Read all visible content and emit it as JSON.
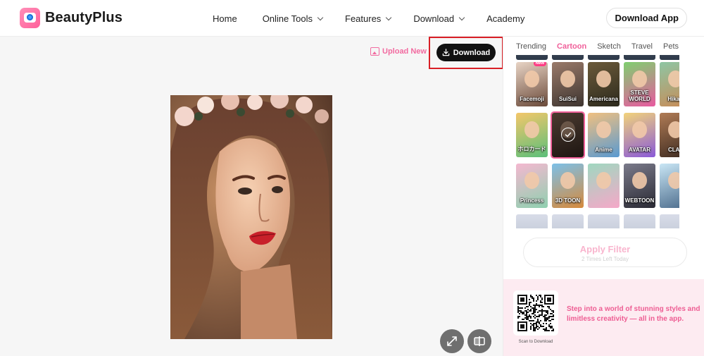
{
  "brand": {
    "name": "BeautyPlus"
  },
  "nav": [
    {
      "label": "Home",
      "dropdown": false
    },
    {
      "label": "Online Tools",
      "dropdown": true
    },
    {
      "label": "Features",
      "dropdown": true
    },
    {
      "label": "Download",
      "dropdown": true
    },
    {
      "label": "Academy",
      "dropdown": false
    }
  ],
  "header": {
    "download_app": "Download App"
  },
  "toolbar": {
    "upload_new": "Upload New",
    "download": "Download"
  },
  "tabs": [
    {
      "label": "Trending",
      "active": false
    },
    {
      "label": "Cartoon",
      "active": true
    },
    {
      "label": "Sketch",
      "active": false
    },
    {
      "label": "Travel",
      "active": false
    },
    {
      "label": "Pets",
      "active": false
    }
  ],
  "filters": [
    {
      "caption": "Facemoji",
      "badge": "New",
      "colors": [
        "#e8d4c5",
        "#6b4a3a"
      ]
    },
    {
      "caption": "SuiSui",
      "colors": [
        "#9a7a6a",
        "#3e3530"
      ]
    },
    {
      "caption": "Americana",
      "colors": [
        "#6b5a3a",
        "#2d2a1d"
      ]
    },
    {
      "caption": "STEVE WORLD",
      "colors": [
        "#7fcf6f",
        "#e85aa0"
      ]
    },
    {
      "caption": "Hikari",
      "colors": [
        "#8ec6a4",
        "#c98a55"
      ]
    },
    {
      "caption": "ホロカード",
      "colors": [
        "#f4c76a",
        "#5bbf7a"
      ]
    },
    {
      "caption": "",
      "selected": true,
      "colors": [
        "#4a3a30",
        "#1e1612"
      ]
    },
    {
      "caption": "Anime",
      "colors": [
        "#f0c080",
        "#5a9ad0"
      ]
    },
    {
      "caption": "AVATAR",
      "colors": [
        "#f2d37a",
        "#8a5ad8"
      ]
    },
    {
      "caption": "CLAY",
      "colors": [
        "#b07b55",
        "#3c2a20"
      ]
    },
    {
      "caption": "Princess",
      "colors": [
        "#f4b8d0",
        "#8fd0b0"
      ]
    },
    {
      "caption": "3D TOON",
      "colors": [
        "#7cc0e8",
        "#d68a3c"
      ]
    },
    {
      "caption": "",
      "colors": [
        "#9fd8c0",
        "#f5a8c8"
      ]
    },
    {
      "caption": "WEBTOON",
      "colors": [
        "#7a7a8a",
        "#2a2a34"
      ]
    },
    {
      "caption": "",
      "colors": [
        "#c9e6f5",
        "#4a6a8a"
      ]
    }
  ],
  "apply": {
    "label": "Apply Filter",
    "sub": "2 Times Left Today"
  },
  "promo": {
    "qr_caption": "Scan to Download",
    "text": "Step into a world of stunning styles and limitless creativity — all in the app."
  },
  "colors": {
    "accent": "#f0609a",
    "highlight": "#d91f26",
    "button": "#111111"
  },
  "icons": {
    "upload": "image-upload-icon",
    "download": "download-tray-icon",
    "fullscreen": "expand-arrows-icon",
    "compare": "compare-split-icon",
    "check": "check-circle-icon"
  }
}
